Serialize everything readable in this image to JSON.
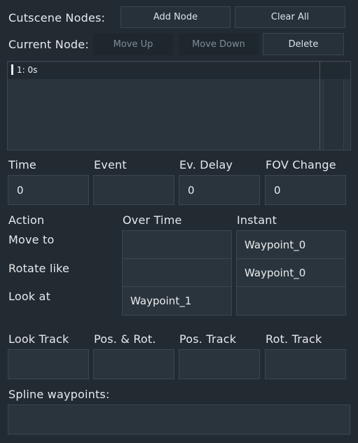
{
  "header": {
    "nodes_label": "Cutscene Nodes:",
    "add_node": "Add Node",
    "clear_all": "Clear All",
    "current_label": "Current Node:",
    "move_up": "Move Up",
    "move_down": "Move Down",
    "delete": "Delete"
  },
  "node_list": {
    "items": [
      {
        "label": "1: 0s",
        "selected": true
      }
    ]
  },
  "fields": {
    "time": {
      "label": "Time",
      "value": "0"
    },
    "event": {
      "label": "Event",
      "value": ""
    },
    "ev_delay": {
      "label": "Ev. Delay",
      "value": "0"
    },
    "fov_change": {
      "label": "FOV Change",
      "value": "0"
    }
  },
  "actions": {
    "col_action": "Action",
    "col_over_time": "Over Time",
    "col_instant": "Instant",
    "rows": [
      {
        "label": "Move to",
        "over_time": "",
        "instant": "Waypoint_0"
      },
      {
        "label": "Rotate like",
        "over_time": "",
        "instant": "Waypoint_0"
      },
      {
        "label": "Look at",
        "over_time": "Waypoint_1",
        "instant": ""
      }
    ]
  },
  "tracks": {
    "look_track": "Look Track",
    "pos_rot": "Pos. & Rot.",
    "pos_track": "Pos. Track",
    "rot_track": "Rot. Track"
  },
  "spline": {
    "label": "Spline waypoints:"
  }
}
